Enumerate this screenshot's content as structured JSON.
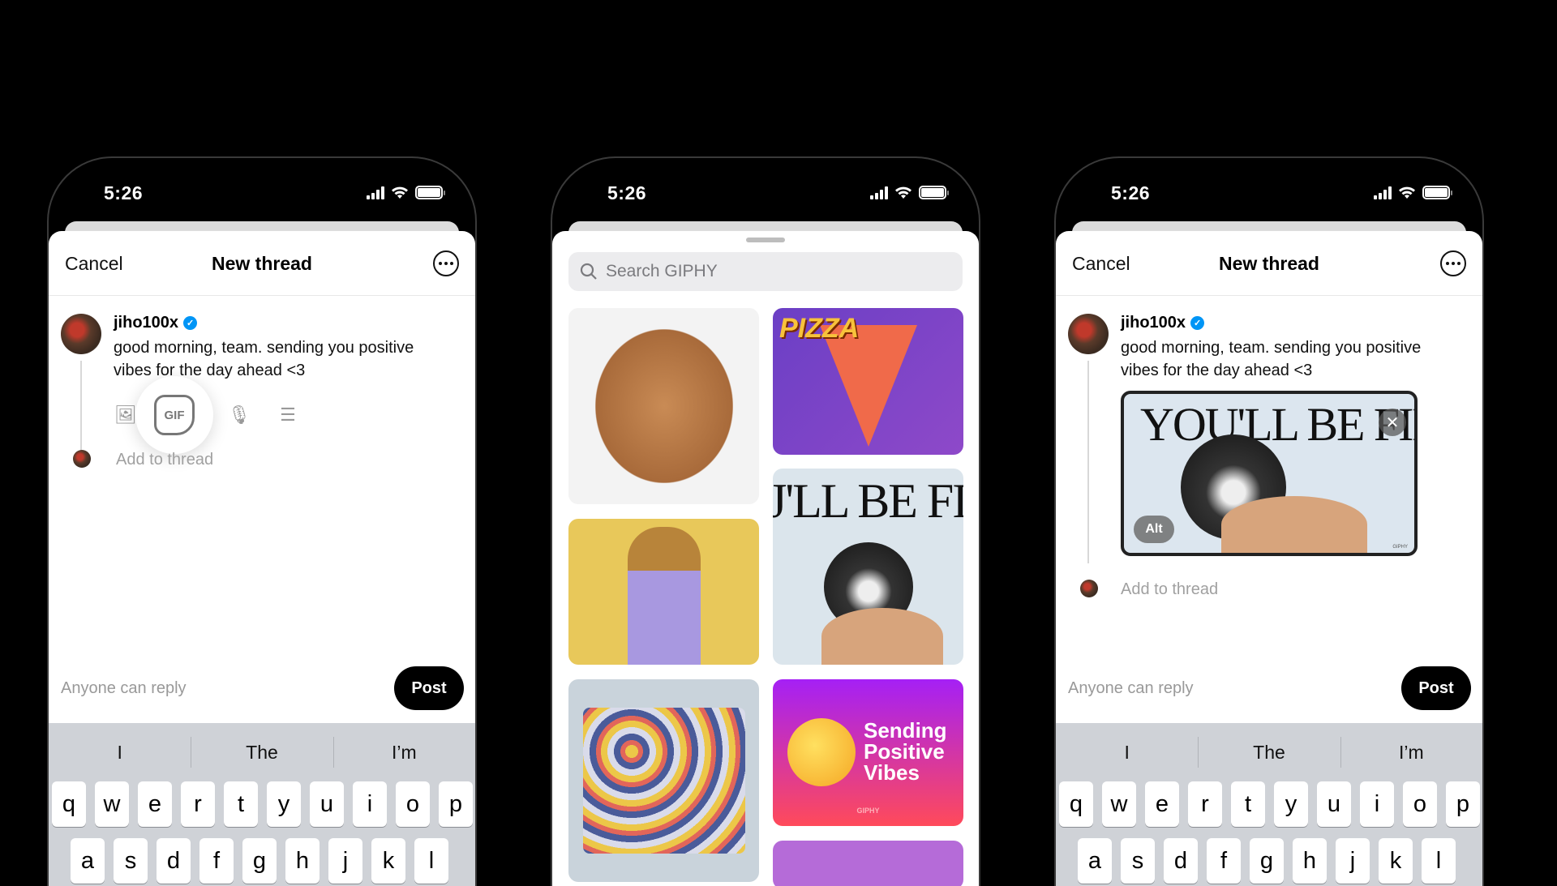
{
  "status_bar": {
    "time": "5:26"
  },
  "compose": {
    "cancel": "Cancel",
    "title": "New thread",
    "username": "jiho100x",
    "post_text_line1": "good morning, team. sending you positive",
    "post_text_line2": "vibes for the day ahead <3",
    "gif_label": "GIF",
    "add_to_thread": "Add to thread",
    "reply_setting": "Anyone can reply",
    "post_button": "Post"
  },
  "tools": [
    "gallery-icon",
    "gif-icon",
    "mic-icon",
    "poll-icon"
  ],
  "giphy": {
    "search_placeholder": "Search GIPHY",
    "results": [
      {
        "name": "dog-with-glasses"
      },
      {
        "name": "pizza",
        "caption": "PIZZA"
      },
      {
        "name": "youll-be-fine-dog",
        "caption": "J'LL BE FI"
      },
      {
        "name": "girl-sunglasses"
      },
      {
        "name": "emoji-toys"
      },
      {
        "name": "sending-positive-vibes",
        "caption_lines": [
          "Sending",
          "Positive",
          "Vibes"
        ],
        "watermark": "GIPHY"
      },
      {
        "name": "person-purple"
      }
    ]
  },
  "attached_gif": {
    "caption": "YOU'LL BE FINE",
    "alt_label": "Alt",
    "watermark": "GIPHY"
  },
  "keyboard": {
    "suggestions": [
      "I",
      "The",
      "I’m"
    ],
    "row1": [
      "q",
      "w",
      "e",
      "r",
      "t",
      "y",
      "u",
      "i",
      "o",
      "p"
    ],
    "row2": [
      "a",
      "s",
      "d",
      "f",
      "g",
      "h",
      "j",
      "k",
      "l"
    ]
  }
}
